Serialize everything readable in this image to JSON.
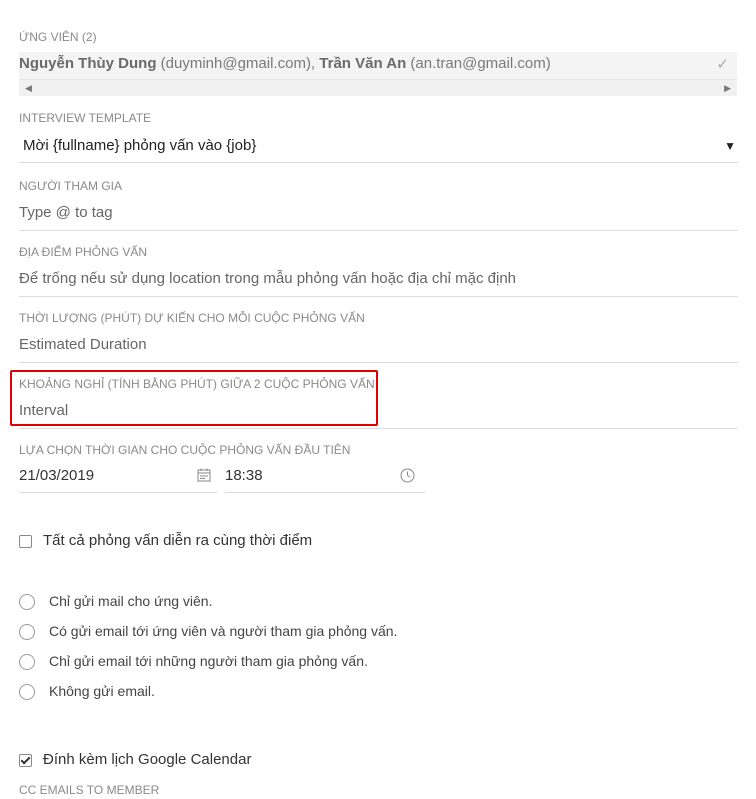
{
  "candidates": {
    "label": "ỨNG VIÊN (2)",
    "items": [
      {
        "name": "Nguyễn Thùy Dung",
        "email": "(duyminh@gmail.com),"
      },
      {
        "name": "Trần Văn An",
        "email": "(an.tran@gmail.com)"
      }
    ]
  },
  "template": {
    "label": "INTERVIEW TEMPLATE",
    "value": "Mời {fullname} phỏng vấn vào {job}"
  },
  "participants": {
    "label": "NGƯỜI THAM GIA",
    "placeholder": "Type @ to tag"
  },
  "location": {
    "label": "ĐỊA ĐIỂM PHỎNG VẤN",
    "placeholder": "Để trống nếu sử dụng location trong mẫu phỏng vấn hoặc địa chỉ mặc định"
  },
  "duration": {
    "label": "THỜI LƯỢNG (PHÚT) DỰ KIẾN CHO MỖI CUỘC PHỎNG VẤN",
    "placeholder": "Estimated Duration"
  },
  "interval": {
    "label": "KHOẢNG NGHỈ (TÍNH BẰNG PHÚT) GIỮA 2 CUỘC PHỎNG VẤN",
    "placeholder": "Interval"
  },
  "first_time": {
    "label": "LỰA CHỌN THỜI GIAN CHO CUỘC PHỎNG VẤN ĐẦU TIÊN",
    "date": "21/03/2019",
    "time": "18:38"
  },
  "same_time": {
    "label": "Tất cả phỏng vấn diễn ra cùng thời điểm",
    "checked": false
  },
  "email_options": [
    "Chỉ gửi mail cho ứng viên.",
    "Có gửi email tới ứng viên và người tham gia phỏng vấn.",
    "Chỉ gửi email tới những người tham gia phỏng vấn.",
    "Không gửi email."
  ],
  "calendar": {
    "label": "Đính kèm lịch Google Calendar",
    "checked": true
  },
  "cc": {
    "label": "CC EMAILS TO MEMBER"
  },
  "colors": {
    "highlight": "#e00000",
    "label_gray": "#8a8a8a"
  }
}
